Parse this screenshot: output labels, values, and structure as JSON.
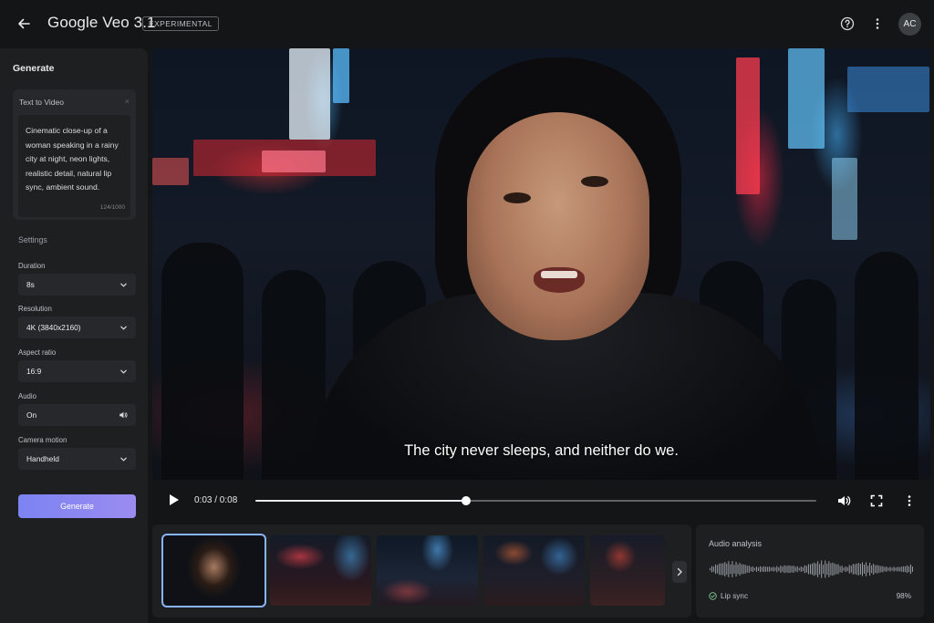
{
  "header": {
    "title": "Google Veo 3.1",
    "badge": "EXPERIMENTAL",
    "avatar_initials": "AC",
    "icons": [
      "back-arrow-icon",
      "help-icon",
      "more-vert-icon"
    ]
  },
  "sidebar": {
    "title": "Generate",
    "prompt": {
      "label": "Text to Video",
      "close_glyph": "×",
      "text": "Cinematic close-up of a woman speaking in a rainy city at night, neon lights, realistic detail, natural lip sync, ambient sound.",
      "char_count": "124/1000"
    },
    "settings_label": "Settings",
    "fields": {
      "duration": {
        "label": "Duration",
        "value": "8s",
        "icon": "chevron-down-icon"
      },
      "resolution": {
        "label": "Resolution",
        "value": "4K (3840x2160)",
        "icon": "chevron-down-icon"
      },
      "aspect_ratio": {
        "label": "Aspect ratio",
        "value": "16:9",
        "icon": "chevron-down-icon"
      },
      "audio": {
        "label": "Audio",
        "value": "On",
        "icon": "volume-icon"
      },
      "camera_motion": {
        "label": "Camera motion",
        "value": "Handheld",
        "icon": "chevron-down-icon"
      }
    },
    "generate_label": "Generate",
    "accent": "#8a86f1"
  },
  "player": {
    "subtitle": "The city never sleeps, and neither do we.",
    "time": "0:03 / 0:08",
    "progress": 0.375,
    "icons": [
      "play-icon",
      "volume-icon",
      "fullscreen-icon",
      "more-vert-icon"
    ]
  },
  "thumbnails": {
    "count": 5,
    "selected_index": 0,
    "next_icon": "chevron-right-icon"
  },
  "audio_analysis": {
    "title": "Audio analysis",
    "lip_sync_label": "Lip sync",
    "lip_sync_value": "98%",
    "status_color": "#81c995"
  }
}
